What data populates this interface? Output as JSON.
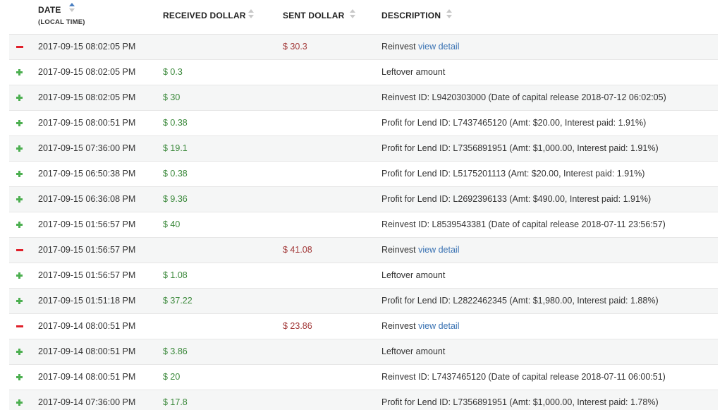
{
  "header": {
    "date_label": "DATE",
    "date_sub": "(LOCAL TIME)",
    "received_label": "RECEIVED DOLLAR",
    "sent_label": "SENT DOLLAR",
    "description_label": "DESCRIPTION"
  },
  "colors": {
    "plus": "#4caf50",
    "minus": "#e0202a",
    "received": "#3d8a3d",
    "sent": "#a33a3a",
    "link": "#3b73b3"
  },
  "rows": [
    {
      "type": "minus",
      "date": "2017-09-15 08:02:05 PM",
      "received": "",
      "sent": "$ 30.3",
      "description": "Reinvest",
      "link": "view detail"
    },
    {
      "type": "plus",
      "date": "2017-09-15 08:02:05 PM",
      "received": "$ 0.3",
      "sent": "",
      "description": "Leftover amount",
      "link": ""
    },
    {
      "type": "plus",
      "date": "2017-09-15 08:02:05 PM",
      "received": "$ 30",
      "sent": "",
      "description": "Reinvest ID: L9420303000 (Date of capital release 2018-07-12 06:02:05)",
      "link": ""
    },
    {
      "type": "plus",
      "date": "2017-09-15 08:00:51 PM",
      "received": "$ 0.38",
      "sent": "",
      "description": "Profit for Lend ID: L7437465120 (Amt: $20.00, Interest paid: 1.91%)",
      "link": ""
    },
    {
      "type": "plus",
      "date": "2017-09-15 07:36:00 PM",
      "received": "$ 19.1",
      "sent": "",
      "description": "Profit for Lend ID: L7356891951 (Amt: $1,000.00, Interest paid: 1.91%)",
      "link": ""
    },
    {
      "type": "plus",
      "date": "2017-09-15 06:50:38 PM",
      "received": "$ 0.38",
      "sent": "",
      "description": "Profit for Lend ID: L5175201113 (Amt: $20.00, Interest paid: 1.91%)",
      "link": ""
    },
    {
      "type": "plus",
      "date": "2017-09-15 06:36:08 PM",
      "received": "$ 9.36",
      "sent": "",
      "description": "Profit for Lend ID: L2692396133 (Amt: $490.00, Interest paid: 1.91%)",
      "link": ""
    },
    {
      "type": "plus",
      "date": "2017-09-15 01:56:57 PM",
      "received": "$ 40",
      "sent": "",
      "description": "Reinvest ID: L8539543381 (Date of capital release 2018-07-11 23:56:57)",
      "link": ""
    },
    {
      "type": "minus",
      "date": "2017-09-15 01:56:57 PM",
      "received": "",
      "sent": "$ 41.08",
      "description": "Reinvest",
      "link": "view detail"
    },
    {
      "type": "plus",
      "date": "2017-09-15 01:56:57 PM",
      "received": "$ 1.08",
      "sent": "",
      "description": "Leftover amount",
      "link": ""
    },
    {
      "type": "plus",
      "date": "2017-09-15 01:51:18 PM",
      "received": "$ 37.22",
      "sent": "",
      "description": "Profit for Lend ID: L2822462345 (Amt: $1,980.00, Interest paid: 1.88%)",
      "link": ""
    },
    {
      "type": "minus",
      "date": "2017-09-14 08:00:51 PM",
      "received": "",
      "sent": "$ 23.86",
      "description": "Reinvest",
      "link": "view detail"
    },
    {
      "type": "plus",
      "date": "2017-09-14 08:00:51 PM",
      "received": "$ 3.86",
      "sent": "",
      "description": "Leftover amount",
      "link": ""
    },
    {
      "type": "plus",
      "date": "2017-09-14 08:00:51 PM",
      "received": "$ 20",
      "sent": "",
      "description": "Reinvest ID: L7437465120 (Date of capital release 2018-07-11 06:00:51)",
      "link": ""
    },
    {
      "type": "plus",
      "date": "2017-09-14 07:36:00 PM",
      "received": "$ 17.8",
      "sent": "",
      "description": "Profit for Lend ID: L7356891951 (Amt: $1,000.00, Interest paid: 1.78%)",
      "link": ""
    }
  ]
}
